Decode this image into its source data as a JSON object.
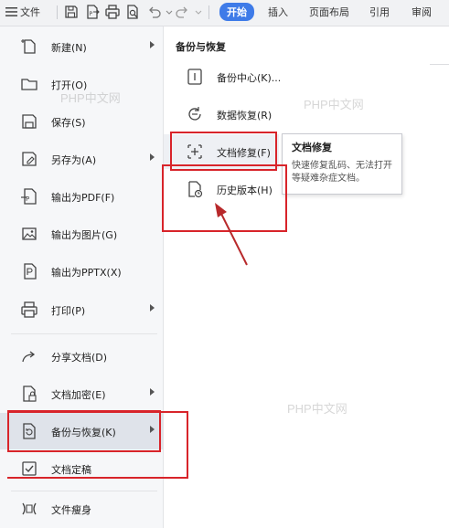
{
  "toolbar": {
    "file_label": "文件",
    "tabs": [
      {
        "label": "开始",
        "active": true
      },
      {
        "label": "插入",
        "active": false
      },
      {
        "label": "页面布局",
        "active": false
      },
      {
        "label": "引用",
        "active": false
      },
      {
        "label": "审阅",
        "active": false
      }
    ],
    "icons": [
      "menu-icon",
      "save-icon",
      "export-pdf-icon",
      "print-icon",
      "print-preview-icon",
      "undo-icon",
      "redo-icon"
    ]
  },
  "file_menu": {
    "items": [
      {
        "label": "新建(N)",
        "icon": "new-file-icon",
        "has_submenu": true
      },
      {
        "label": "打开(O)",
        "icon": "folder-icon",
        "has_submenu": false
      },
      {
        "label": "保存(S)",
        "icon": "save-icon",
        "has_submenu": false
      },
      {
        "label": "另存为(A)",
        "icon": "save-as-icon",
        "has_submenu": true
      },
      {
        "label": "输出为PDF(F)",
        "icon": "pdf-icon",
        "has_submenu": false
      },
      {
        "label": "输出为图片(G)",
        "icon": "image-icon",
        "has_submenu": false
      },
      {
        "label": "输出为PPTX(X)",
        "icon": "pptx-icon",
        "has_submenu": false
      },
      {
        "label": "打印(P)",
        "icon": "print-icon",
        "has_submenu": true
      },
      {
        "label": "分享文档(D)",
        "icon": "share-icon",
        "has_submenu": false
      },
      {
        "label": "文档加密(E)",
        "icon": "encrypt-icon",
        "has_submenu": true
      },
      {
        "label": "备份与恢复(K)",
        "icon": "backup-icon",
        "has_submenu": true,
        "selected": true
      },
      {
        "label": "文档定稿",
        "icon": "finalize-icon",
        "has_submenu": false
      },
      {
        "label": "文件瘦身",
        "icon": "slim-icon",
        "has_submenu": false
      }
    ]
  },
  "backup_panel": {
    "title": "备份与恢复",
    "items": [
      {
        "label": "备份中心(K)...",
        "icon": "backup-center-icon"
      },
      {
        "label": "数据恢复(R)",
        "icon": "data-recovery-icon"
      },
      {
        "label": "文档修复(F)",
        "icon": "doc-repair-icon",
        "hover": true
      },
      {
        "label": "历史版本(H)",
        "icon": "history-version-icon"
      }
    ]
  },
  "tooltip": {
    "title": "文档修复",
    "body": "快速修复乱码、无法打开等疑难杂症文档。"
  },
  "watermarks": [
    "PHP中文网",
    "PHP中文网",
    "PHP中文网"
  ],
  "colors": {
    "accent": "#3e7be8",
    "annotation_red": "#d8242a",
    "menu_bg": "#f6f7f9",
    "selected_bg": "#dfe3ea"
  }
}
